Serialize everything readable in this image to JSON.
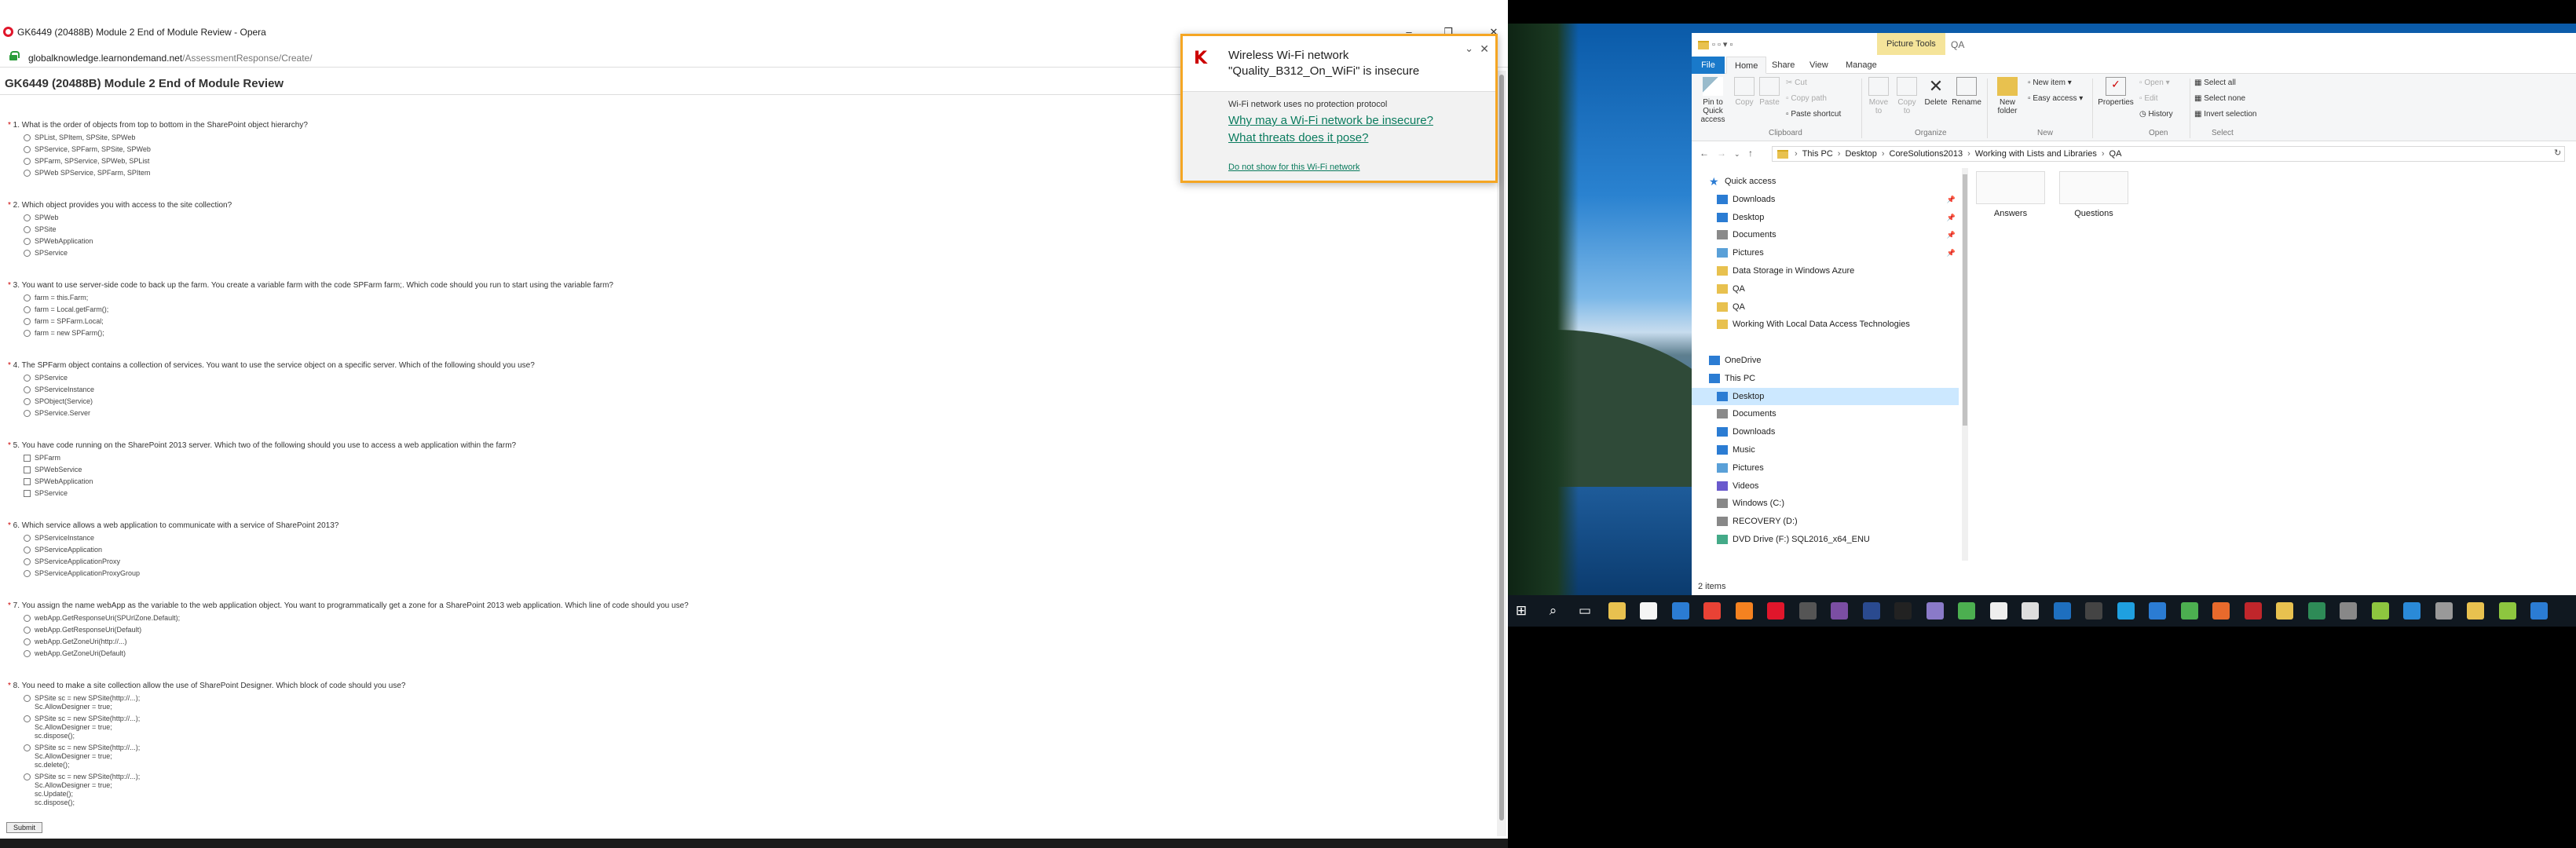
{
  "browser": {
    "window_title": "GK6449 (20488B) Module 2 End of Module Review - Opera",
    "url_domain": "globalknowledge.learnondemand.net",
    "url_path": "/AssessmentResponse/Create/",
    "page_title": "GK6449 (20488B) Module 2 End of Module Review",
    "submit_label": "Submit"
  },
  "questions": [
    {
      "num": "1.",
      "text": "What is the order of objects from top to bottom in the SharePoint object hierarchy?",
      "type": "radio",
      "options": [
        "SPList, SPItem, SPSite, SPWeb",
        "SPService, SPFarm, SPSite, SPWeb",
        "SPFarm, SPService, SPWeb, SPList",
        "SPWeb SPService, SPFarm, SPItem"
      ]
    },
    {
      "num": "2.",
      "text": "Which object provides you with access to the site collection?",
      "type": "radio",
      "options": [
        "SPWeb",
        "SPSite",
        "SPWebApplication",
        "SPService"
      ]
    },
    {
      "num": "3.",
      "text": "You want to use server-side code to back up the farm. You create a variable farm with the code SPFarm farm;. Which code should you run to start using the variable farm?",
      "type": "radio",
      "options": [
        "farm = this.Farm;",
        "farm = Local.getFarm();",
        "farm = SPFarm.Local;",
        "farm = new SPFarm();"
      ]
    },
    {
      "num": "4.",
      "text": "The SPFarm object contains a collection of services. You want to use the service object on a specific server. Which of the following should you use?",
      "type": "radio",
      "options": [
        "SPService",
        "SPServiceInstance",
        "SPObject(Service)",
        "SPService.Server"
      ]
    },
    {
      "num": "5.",
      "text": "You have code running on the SharePoint 2013 server. Which two of the following should you use to access a web application within the farm?",
      "type": "checkbox",
      "options": [
        "SPFarm",
        "SPWebService",
        "SPWebApplication",
        "SPService"
      ]
    },
    {
      "num": "6.",
      "text": "Which service allows a web application to communicate with a service of SharePoint 2013?",
      "type": "radio",
      "options": [
        "SPServiceInstance",
        "SPServiceApplication",
        "SPServiceApplicationProxy",
        "SPServiceApplicationProxyGroup"
      ]
    },
    {
      "num": "7.",
      "text": "You assign the name webApp as the variable to the web application object. You want to programmatically get a zone for a SharePoint 2013 web application. Which line of code should you use?",
      "type": "radio",
      "options": [
        "webApp.GetResponseUri(SPUrlZone.Default);",
        "webApp.GetResponseUri(Default)",
        "webApp.GetZoneUri(http://...)",
        "webApp.GetZoneUri(Default)"
      ]
    },
    {
      "num": "8.",
      "text": "You need to make a site collection allow the use of SharePoint Designer. Which block of code should you use?",
      "type": "radio",
      "options": [
        [
          "SPSite sc = new SPSite(http://...);",
          "Sc.AllowDesigner = true;"
        ],
        [
          "SPSite sc = new SPSite(http://...);",
          "Sc.AllowDesigner = true;",
          "sc.dispose();"
        ],
        [
          "SPSite sc = new SPSite(http://...);",
          "Sc.AllowDesigner = true;",
          "sc.delete();"
        ],
        [
          "SPSite sc = new SPSite(http://...);",
          "Sc.AllowDesigner = true;",
          "sc.Update();",
          "sc.dispose();"
        ]
      ]
    }
  ],
  "popup": {
    "title_line1": "Wireless Wi-Fi network",
    "title_line2": "\"Quality_B312_On_WiFi\" is insecure",
    "message": "Wi-Fi network uses no protection protocol",
    "link1": "Why may a Wi-Fi network be insecure?",
    "link2": "What threats does it pose?",
    "dismiss": "Do not show for this Wi-Fi network"
  },
  "explorer": {
    "context_tab": "Picture Tools",
    "window_title": "QA",
    "tabs": [
      "File",
      "Home",
      "Share",
      "View",
      "Manage"
    ],
    "ribbon": {
      "pin": "Pin to Quick access",
      "copy": "Copy",
      "paste": "Paste",
      "cut": "Cut",
      "copy_path": "Copy path",
      "paste_shortcut": "Paste shortcut",
      "clipboard": "Clipboard",
      "move_to": "Move to",
      "copy_to": "Copy to",
      "delete": "Delete",
      "rename": "Rename",
      "organize": "Organize",
      "new_folder": "New folder",
      "new_item": "New item",
      "easy_access": "Easy access",
      "new": "New",
      "properties": "Properties",
      "open": "Open",
      "edit": "Edit",
      "history": "History",
      "open_grp": "Open",
      "select_all": "Select all",
      "select_none": "Select none",
      "invert": "Invert selection",
      "select_grp": "Select"
    },
    "breadcrumb": [
      "This PC",
      "Desktop",
      "CoreSolutions2013",
      "Working with Lists and Libraries",
      "QA"
    ],
    "nav": [
      {
        "label": "Quick access",
        "icon": "star-icon"
      },
      {
        "label": "Downloads",
        "icon": "downloads-icon",
        "pinned": true
      },
      {
        "label": "Desktop",
        "icon": "desktop-icon",
        "pinned": true
      },
      {
        "label": "Documents",
        "icon": "documents-icon",
        "pinned": true
      },
      {
        "label": "Pictures",
        "icon": "pictures-icon",
        "pinned": true
      },
      {
        "label": "Data Storage in Windows Azure",
        "icon": "folder-icon"
      },
      {
        "label": "QA",
        "icon": "folder-icon"
      },
      {
        "label": "QA",
        "icon": "folder-icon"
      },
      {
        "label": "Working With Local Data Access Technologies",
        "icon": "folder-icon"
      },
      {
        "label": "OneDrive",
        "icon": "cloud-icon"
      },
      {
        "label": "This PC",
        "icon": "pc-icon"
      },
      {
        "label": "Desktop",
        "icon": "desktop-icon",
        "selected": true
      },
      {
        "label": "Documents",
        "icon": "documents-icon"
      },
      {
        "label": "Downloads",
        "icon": "downloads-icon"
      },
      {
        "label": "Music",
        "icon": "music-icon"
      },
      {
        "label": "Pictures",
        "icon": "pictures-icon"
      },
      {
        "label": "Videos",
        "icon": "videos-icon"
      },
      {
        "label": "Windows (C:)",
        "icon": "drive-icon"
      },
      {
        "label": "RECOVERY (D:)",
        "icon": "drive-icon"
      },
      {
        "label": "DVD Drive (F:) SQL2016_x64_ENU",
        "icon": "dvd-icon"
      }
    ],
    "items": [
      "Answers",
      "Questions"
    ],
    "status": "2 items"
  },
  "colors": {
    "accent": "#1979ca",
    "popup_border": "#f5a623",
    "link": "#0a7b5e",
    "selection": "#cce8ff"
  }
}
